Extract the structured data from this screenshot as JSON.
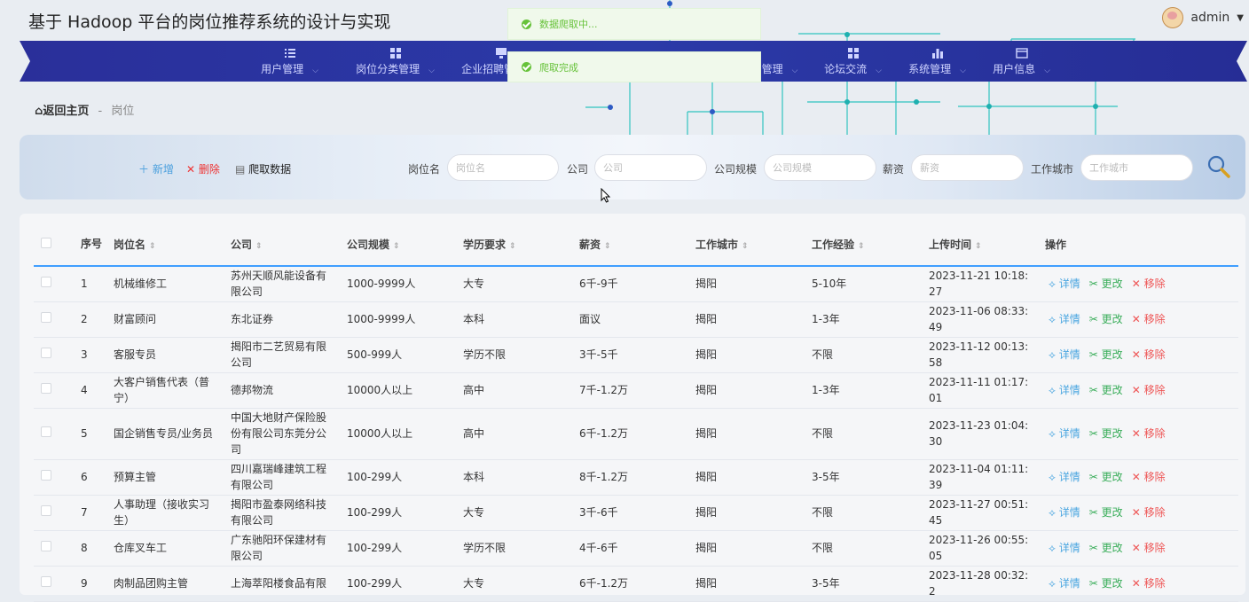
{
  "app": {
    "title": "基于 Hadoop 平台的岗位推荐系统的设计与实现",
    "user": "admin"
  },
  "nav": {
    "items": [
      {
        "label": "用户管理",
        "icon": "list-icon"
      },
      {
        "label": "岗位分类管理",
        "icon": "grid-icon"
      },
      {
        "label": "企业招聘管理",
        "icon": "monitor-icon"
      },
      {
        "label": "",
        "icon": "hidden"
      },
      {
        "label": "",
        "icon": "hidden"
      },
      {
        "label": "管理",
        "icon": "hidden"
      },
      {
        "label": "论坛交流",
        "icon": "grid-icon"
      },
      {
        "label": "系统管理",
        "icon": "bar-chart-icon"
      },
      {
        "label": "用户信息",
        "icon": "card-icon"
      }
    ]
  },
  "toasts": [
    {
      "text": "数据爬取中..."
    },
    {
      "text": "爬取完成"
    }
  ],
  "breadcrumb": {
    "home": "返回主页",
    "sep": "-",
    "current": "岗位"
  },
  "toolbar": {
    "add": "新增",
    "delete": "删除",
    "crawl": "爬取数据"
  },
  "filters": [
    {
      "label": "岗位名",
      "placeholder": "岗位名"
    },
    {
      "label": "公司",
      "placeholder": "公司"
    },
    {
      "label": "公司规模",
      "placeholder": "公司规模"
    },
    {
      "label": "薪资",
      "placeholder": "薪资"
    },
    {
      "label": "工作城市",
      "placeholder": "工作城市"
    }
  ],
  "table": {
    "columns": [
      "序号",
      "岗位名",
      "公司",
      "公司规模",
      "学历要求",
      "薪资",
      "工作城市",
      "工作经验",
      "上传时间",
      "操作"
    ],
    "actions": {
      "detail": "详情",
      "edit": "更改",
      "remove": "移除"
    },
    "rows": [
      {
        "no": "1",
        "name": "机械维修工",
        "company": "苏州天顺风能设备有限公司",
        "size": "1000-9999人",
        "edu": "大专",
        "salary": "6千-9千",
        "city": "揭阳",
        "exp": "5-10年",
        "time": "2023-11-21 10:18:27"
      },
      {
        "no": "2",
        "name": "财富顾问",
        "company": "东北证券",
        "size": "1000-9999人",
        "edu": "本科",
        "salary": "面议",
        "city": "揭阳",
        "exp": "1-3年",
        "time": "2023-11-06 08:33:49"
      },
      {
        "no": "3",
        "name": "客服专员",
        "company": "揭阳市二艺贸易有限公司",
        "size": "500-999人",
        "edu": "学历不限",
        "salary": "3千-5千",
        "city": "揭阳",
        "exp": "不限",
        "time": "2023-11-12 00:13:58"
      },
      {
        "no": "4",
        "name": "大客户销售代表（普宁）",
        "company": "德邦物流",
        "size": "10000人以上",
        "edu": "高中",
        "salary": "7千-1.2万",
        "city": "揭阳",
        "exp": "1-3年",
        "time": "2023-11-11 01:17:01"
      },
      {
        "no": "5",
        "name": "国企销售专员/业务员",
        "company": "中国大地财产保险股份有限公司东莞分公司",
        "size": "10000人以上",
        "edu": "高中",
        "salary": "6千-1.2万",
        "city": "揭阳",
        "exp": "不限",
        "time": "2023-11-23 01:04:30"
      },
      {
        "no": "6",
        "name": "预算主管",
        "company": "四川嘉瑞峰建筑工程有限公司",
        "size": "100-299人",
        "edu": "本科",
        "salary": "8千-1.2万",
        "city": "揭阳",
        "exp": "3-5年",
        "time": "2023-11-04 01:11:39"
      },
      {
        "no": "7",
        "name": "人事助理（接收实习生）",
        "company": "揭阳市盈泰网络科技有限公司",
        "size": "100-299人",
        "edu": "大专",
        "salary": "3千-6千",
        "city": "揭阳",
        "exp": "不限",
        "time": "2023-11-27 00:51:45"
      },
      {
        "no": "8",
        "name": "仓库叉车工",
        "company": "广东驰阳环保建材有限公司",
        "size": "100-299人",
        "edu": "学历不限",
        "salary": "4千-6千",
        "city": "揭阳",
        "exp": "不限",
        "time": "2023-11-26 00:55:05"
      },
      {
        "no": "9",
        "name": "肉制品团购主管",
        "company": "上海萃阳楼食品有限",
        "size": "100-299人",
        "edu": "大专",
        "salary": "6千-1.2万",
        "city": "揭阳",
        "exp": "3-5年",
        "time": "2023-11-28 00:32:2"
      }
    ]
  },
  "colors": {
    "nav": "#2b2f9e",
    "accent": "#409eff",
    "success": "#67c23a",
    "danger": "#e55"
  }
}
